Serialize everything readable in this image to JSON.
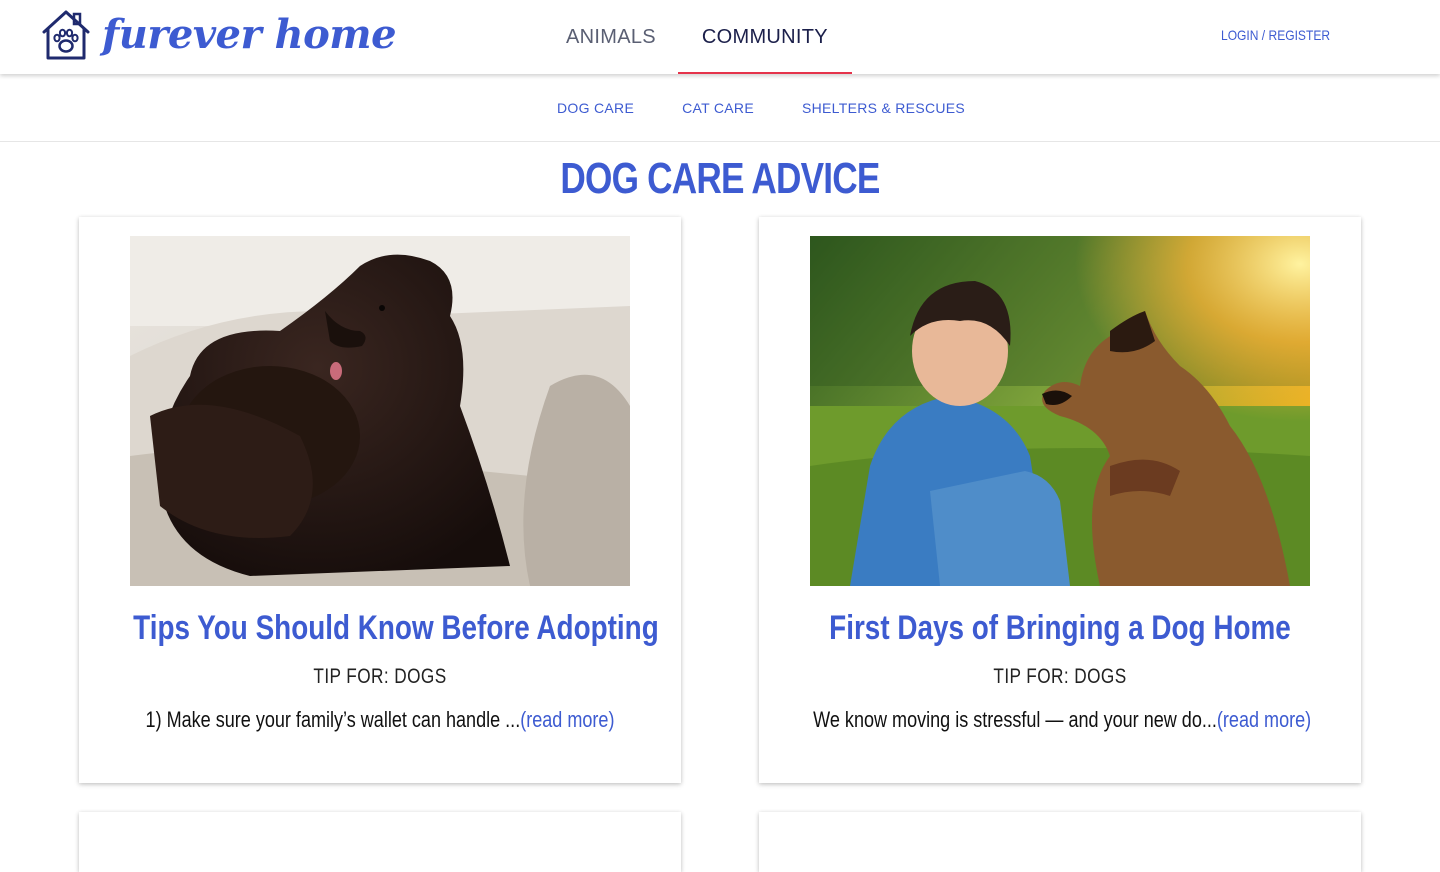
{
  "brand": {
    "name": "furever home"
  },
  "nav": {
    "main": [
      {
        "label": "ANIMALS",
        "active": false
      },
      {
        "label": "COMMUNITY",
        "active": true
      }
    ],
    "login": "LOGIN / REGISTER",
    "sub": [
      "DOG CARE",
      "CAT CARE",
      "SHELTERS & RESCUES"
    ]
  },
  "page": {
    "title": "DOG CARE ADVICE"
  },
  "cards": [
    {
      "title": "Tips You Should Know Before Adopting",
      "tag": "TIP FOR: DOGS",
      "excerpt": "1) Make sure your family’s wallet can handle ...",
      "more": "(read more)",
      "image": "black-newfoundland-dog-on-sofa"
    },
    {
      "title": "First Days of Bringing a Dog Home",
      "tag": "TIP FOR: DOGS",
      "excerpt": "We know moving is stressful — and your new do...",
      "more": "(read more)",
      "image": "boy-with-german-shepherd-in-field"
    }
  ],
  "colors": {
    "brand_blue": "#3d5bd1",
    "active_underline": "#e5334b",
    "nav_dark": "#1b1f4a"
  }
}
